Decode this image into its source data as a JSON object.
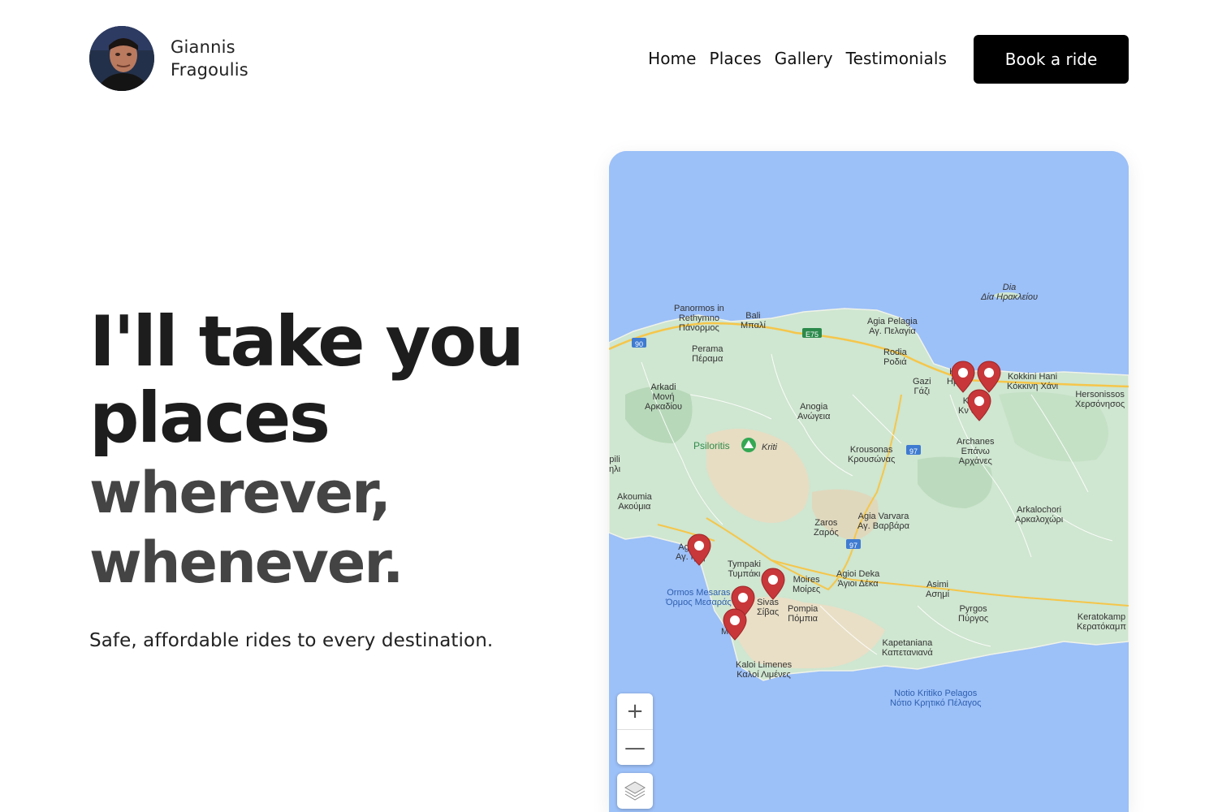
{
  "header": {
    "name_first": "Giannis",
    "name_last": "Fragoulis",
    "nav": [
      "Home",
      "Places",
      "Gallery",
      "Testimonials"
    ],
    "cta_label": "Book a ride"
  },
  "hero": {
    "title_line1": "I'll take you",
    "title_line2": "places",
    "subtitle_line1": "wherever,",
    "subtitle_line2": "whenever.",
    "tagline": "Safe, affordable rides to every destination."
  },
  "map": {
    "zoom_in": "+",
    "zoom_out": "—",
    "labels": {
      "dia": [
        "Dia",
        "Δία Ηρακλείου"
      ],
      "panormos": [
        "Panormos in",
        "Rethymno",
        "Πάνορμος"
      ],
      "bali": [
        "Bali",
        "Μπαλί"
      ],
      "agia_pelagia": [
        "Agia Pelagia",
        "Αγ. Πελαγία"
      ],
      "rodia": [
        "Rodia",
        "Ροδιά"
      ],
      "gazi": [
        "Gazi",
        "Γάζι"
      ],
      "heraklion": [
        "H",
        "Ηρ"
      ],
      "kokkini_hani": [
        "Kokkini Hani",
        "Κόκκινη Χάνι"
      ],
      "hersonissos": [
        "Hersonissos",
        "Χερσόνησος"
      ],
      "perama": [
        "Perama",
        "Πέραμα"
      ],
      "arkadi": [
        "Arkadi",
        "Μονή",
        "Αρκαδίου"
      ],
      "anogia": [
        "Anogia",
        "Ανώγεια"
      ],
      "knossos": [
        "Κ   s",
        "Κν   ός"
      ],
      "psiloritis": "Psiloritis",
      "kriti": "Kriti",
      "krousonas": [
        "Krousonas",
        "Κρουσώνας"
      ],
      "archanes": [
        "Archanes",
        "Επάνω",
        "Αρχάνες"
      ],
      "spili": [
        "pili",
        "ηλι"
      ],
      "akoumia": [
        "Akoumia",
        "Ακούμια"
      ],
      "zaros": [
        "Zaros",
        "Ζαρός"
      ],
      "agia_varvara": [
        "Agia Varvara",
        "Αγ. Βαρβάρα"
      ],
      "arkalochori": [
        "Arkalochori",
        "Αρκαλοχώρι"
      ],
      "agia_galini": [
        "Ag   lini",
        "Αγ.   ήνη"
      ],
      "tympaki": [
        "Tympaki",
        "Τυμπάκι"
      ],
      "moires": [
        "Moires",
        "Μοίρες"
      ],
      "agioi_deka": [
        "Agioi Deka",
        "Άγιοι Δέκα"
      ],
      "asimi": [
        "Asimi",
        "Ασημί"
      ],
      "ormos_mesaras": [
        "Ormos Mesaras",
        "Όρμος Μεσαράς"
      ],
      "sivas": [
        "Sivas",
        "Σίβας"
      ],
      "pompia": [
        "Pompia",
        "Πόμπια"
      ],
      "pyrgos": [
        "Pyrgos",
        "Πύργος"
      ],
      "keratokampos": [
        "Keratokamp",
        "Κερατόκαμπ"
      ],
      "matala": [
        "M   a",
        "Μ   λα"
      ],
      "kapetaniana": [
        "Kapetaniana",
        "Καπετανιανά"
      ],
      "kaloi_limenes": [
        "Kaloi Limenes",
        "Καλοί Λιμένες"
      ],
      "notio": [
        "Notio Kritiko Pelagos",
        "Νότιο Κρητικό Πέλαγος"
      ],
      "road_90": "90",
      "road_e75": "E75",
      "road_97a": "97",
      "road_97b": "97"
    }
  },
  "colors": {
    "sea": "#9cc0f8",
    "land": "#cfe6d0",
    "pin": "#c8373a",
    "cta_bg": "#000000"
  }
}
